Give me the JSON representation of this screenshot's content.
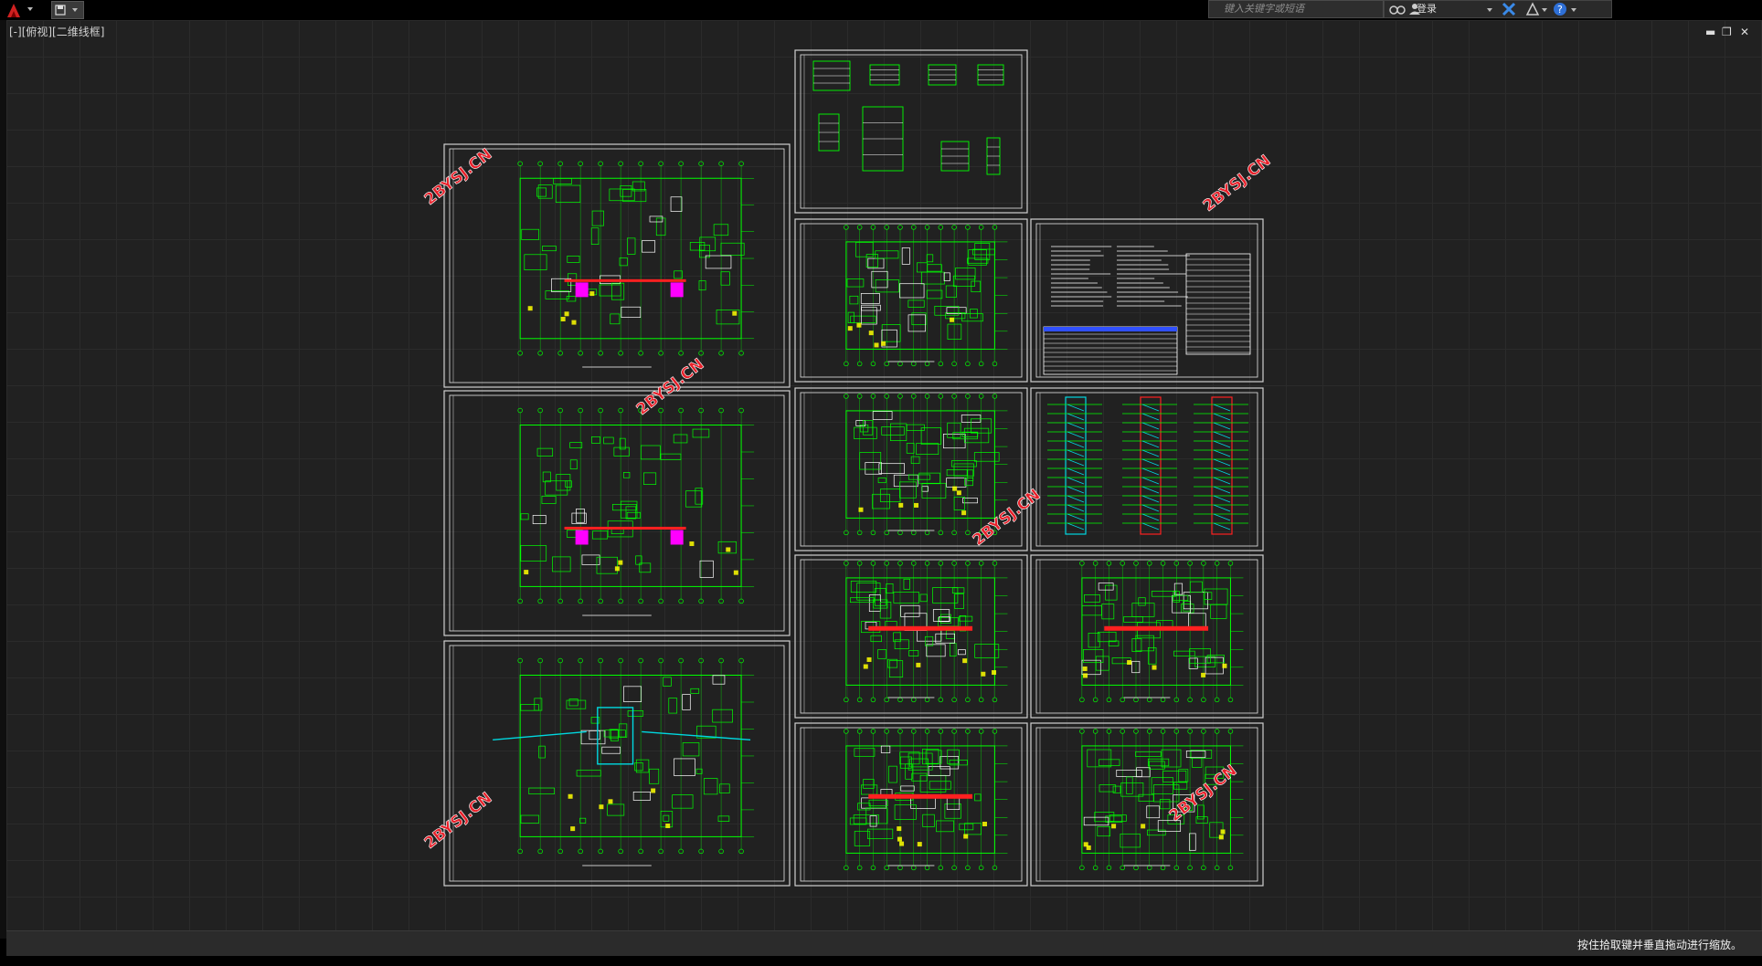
{
  "search": {
    "placeholder": "键入关键字或短语"
  },
  "toolbar": {
    "login_label": "登录"
  },
  "viewport": {
    "label": "[-][俯视][二维线框]"
  },
  "watermark": "2BYSJ.CN",
  "status": {
    "prompt": "按住拾取键并垂直拖动进行缩放。"
  },
  "colors": {
    "canvas_bg": "#212121",
    "drawing_green": "#00ff00",
    "drawing_white": "#ffffff",
    "accent_magenta": "#ff00ff",
    "accent_cyan": "#00d8e0",
    "accent_yellow": "#ffff00",
    "accent_red": "#ff2020",
    "watermark_red": "#e8202a"
  }
}
